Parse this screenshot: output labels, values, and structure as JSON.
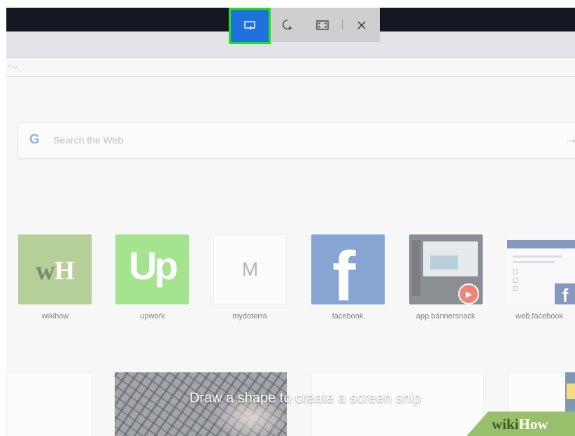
{
  "snip_toolbar": {
    "buttons": [
      {
        "name": "rectangular-snip",
        "icon": "rectangle-snip-icon",
        "active": true
      },
      {
        "name": "freeform-snip",
        "icon": "freeform-snip-icon",
        "active": false
      },
      {
        "name": "fullscreen-snip",
        "icon": "fullscreen-snip-icon",
        "active": false
      },
      {
        "name": "close",
        "icon": "close-icon",
        "active": false
      }
    ],
    "highlight_color": "#19e619",
    "active_color": "#1f72dc"
  },
  "address_bar": {
    "text": "- ..."
  },
  "search": {
    "g_glyph": "G",
    "placeholder": "Search the Web",
    "arrow_icon": "arrow-right-icon"
  },
  "speed_dial": [
    {
      "id": "wikihow",
      "label": "wikihow",
      "logo_text_a": "w",
      "logo_text_b": "H"
    },
    {
      "id": "upwork",
      "label": "upwork",
      "logo_text": "Up"
    },
    {
      "id": "mydoterra",
      "label": "mydoterra",
      "logo_text": "M"
    },
    {
      "id": "facebook",
      "label": "facebook",
      "logo_text": "f"
    },
    {
      "id": "app-bannersnack",
      "label": "app.bannersnack"
    },
    {
      "id": "web-facebook",
      "label": "web.facebook",
      "logo_text": "f"
    }
  ],
  "caption": "Draw a shape to create a screen snip",
  "watermark": {
    "part_a": "wiki",
    "part_b": "How"
  }
}
